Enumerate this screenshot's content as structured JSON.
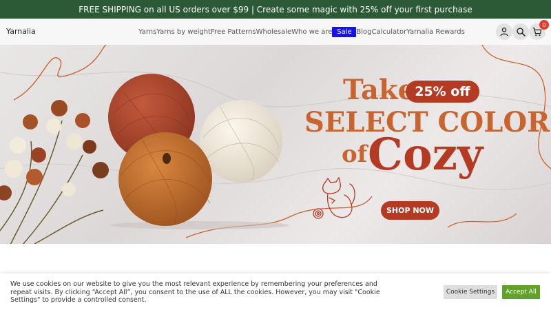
{
  "promo_bar": {
    "text": "FREE SHIPPING on all US orders over $99 | Create some magic with 25% off your first purchase"
  },
  "header": {
    "logo": "Yarnalia",
    "nav": [
      {
        "label": "Yarns"
      },
      {
        "label": "Yarns by weight"
      },
      {
        "label": "Free Patterns"
      },
      {
        "label": "Wholesale"
      },
      {
        "label": "Who we are"
      },
      {
        "label": "Sale"
      },
      {
        "label": "Blog"
      },
      {
        "label": "Calculator"
      },
      {
        "label": "Yarnalia Rewards"
      }
    ],
    "icons": {
      "account": "user-icon",
      "search": "search-icon",
      "cart": "cart-icon"
    },
    "cart_count": "0"
  },
  "hero": {
    "line1": "Take",
    "pill": "25% off",
    "line2": "SELECT COLORS",
    "line3a": "of",
    "line3b": "Cozy",
    "cta": "SHOP NOW",
    "colors": {
      "text": "#c9642f",
      "accent": "#b53a24"
    }
  },
  "cookie": {
    "text": "We use cookies on our website to give you the most relevant experience by remembering your preferences and repeat visits. By clicking “Accept All”, you consent to the use of ALL the cookies. However, you may visit \"Cookie Settings\" to provide a controlled consent.",
    "settings_label": "Cookie Settings",
    "accept_label": "Accept All"
  },
  "colors": {
    "promo_bg": "#2d5a36",
    "sale_bg": "#1a0ff0",
    "badge": "#e53a2c",
    "accept_bg": "#61a229"
  }
}
